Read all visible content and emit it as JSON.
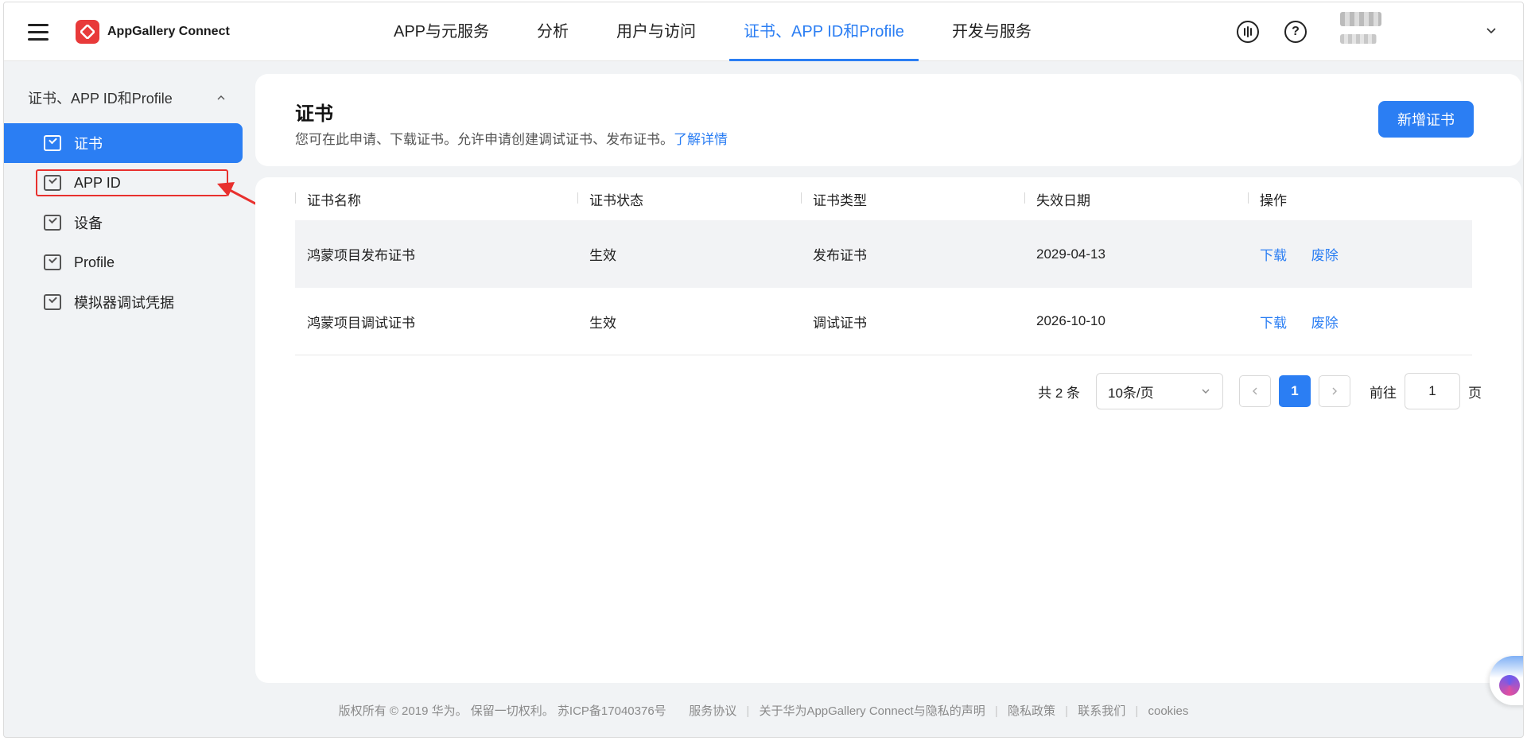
{
  "app": {
    "brand": "AppGallery Connect",
    "brand_color": "#e83a3a",
    "accent_color": "#2b7ef3"
  },
  "topnav": {
    "tabs": [
      {
        "label": "APP与元服务",
        "active": false
      },
      {
        "label": "分析",
        "active": false
      },
      {
        "label": "用户与访问",
        "active": false
      },
      {
        "label": "证书、APP ID和Profile",
        "active": true
      },
      {
        "label": "开发与服务",
        "active": false
      }
    ],
    "icons": [
      "feedback-icon",
      "help-icon"
    ],
    "help_glyph": "?"
  },
  "sidebar": {
    "group_label": "证书、APP ID和Profile",
    "items": [
      {
        "label": "证书",
        "active": true
      },
      {
        "label": "APP ID",
        "active": false
      },
      {
        "label": "设备",
        "active": false
      },
      {
        "label": "Profile",
        "active": false
      },
      {
        "label": "模拟器调试凭据",
        "active": false
      }
    ]
  },
  "header_card": {
    "title": "证书",
    "description": "您可在此申请、下载证书。允许申请创建调试证书、发布证书。",
    "learn_more": "了解详情",
    "add_button": "新增证书"
  },
  "table": {
    "columns": [
      "证书名称",
      "证书状态",
      "证书类型",
      "失效日期",
      "操作"
    ],
    "rows": [
      {
        "name": "鸿蒙项目发布证书",
        "status": "生效",
        "type": "发布证书",
        "expiry": "2029-04-13",
        "action_download": "下载",
        "action_revoke": "废除"
      },
      {
        "name": "鸿蒙项目调试证书",
        "status": "生效",
        "type": "调试证书",
        "expiry": "2026-10-10",
        "action_download": "下载",
        "action_revoke": "废除"
      }
    ]
  },
  "pagination": {
    "total": "共 2 条",
    "page_size": "10条/页",
    "current_page": "1",
    "goto_label": "前往",
    "goto_value": "1",
    "page_word": "页"
  },
  "footer": {
    "copyright": "版权所有 © 2019 华为。 保留一切权利。 苏ICP备17040376号",
    "links": [
      "服务协议",
      "关于华为AppGallery Connect与隐私的声明",
      "隐私政策",
      "联系我们",
      "cookies"
    ]
  }
}
